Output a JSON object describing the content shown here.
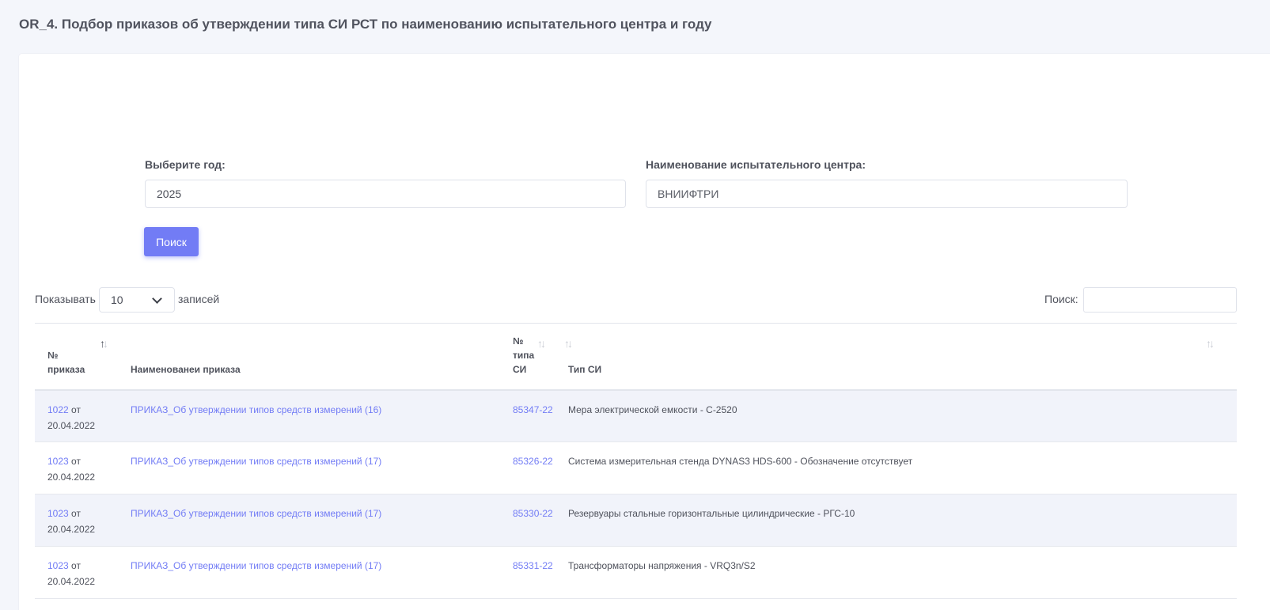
{
  "page": {
    "title": "OR_4. Подбор приказов об утверждении типа СИ РСТ по наименованию испытательного центра и году"
  },
  "form": {
    "year_label": "Выберите год:",
    "year_value": "2025",
    "center_label": "Наименование испытательного центра:",
    "center_value": "ВНИИФТРИ",
    "search_button": "Поиск"
  },
  "table_controls": {
    "length_prefix": "Показывать",
    "length_value": "10",
    "length_suffix": "записей",
    "filter_label": "Поиск:",
    "filter_value": ""
  },
  "table": {
    "headers": {
      "order_no_l1": "№",
      "order_no_l2": "приказа",
      "order_name": "Наименованеи приказа",
      "type_no_l1": "№",
      "type_no_l2": "типа",
      "type_no_l3": "СИ",
      "si_type": "Тип СИ"
    },
    "rows": [
      {
        "order_no": "1022",
        "order_date": " от 20.04.2022",
        "order_name": "ПРИКАЗ_Об утверждении типов средств измерений (16)",
        "type_no": "85347-22",
        "si_type": "Мера электрической емкости - С-2520"
      },
      {
        "order_no": "1023",
        "order_date": " от 20.04.2022",
        "order_name": "ПРИКАЗ_Об утверждении типов средств измерений (17)",
        "type_no": "85326-22",
        "si_type": "Система измерительная стенда DYNAS3 HDS-600 - Обозначение отсутствует"
      },
      {
        "order_no": "1023",
        "order_date": " от 20.04.2022",
        "order_name": "ПРИКАЗ_Об утверждении типов средств измерений (17)",
        "type_no": "85330-22",
        "si_type": "Резервуары стальные горизонтальные цилиндрические - РГС-10"
      },
      {
        "order_no": "1023",
        "order_date": " от 20.04.2022",
        "order_name": "ПРИКАЗ_Об утверждении типов средств измерений (17)",
        "type_no": "85331-22",
        "si_type": "Трансформаторы напряжения - VRQ3n/S2"
      }
    ]
  },
  "colors": {
    "accent": "#727cf5",
    "row_stripe": "#f1f3fa",
    "page_bg": "#f4f6fb"
  }
}
